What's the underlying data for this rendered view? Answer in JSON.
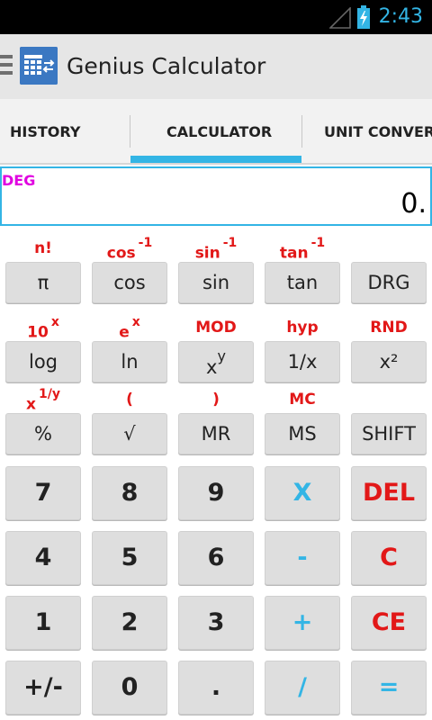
{
  "status": {
    "time": "2:43"
  },
  "app": {
    "title": "Genius Calculator"
  },
  "tabs": [
    {
      "label": "HISTORY"
    },
    {
      "label": "CALCULATOR"
    },
    {
      "label": "UNIT CONVERT"
    }
  ],
  "display": {
    "mode": "DEG",
    "value": "0."
  },
  "shift_labels": {
    "row1": [
      {
        "base": "n!",
        "sup": ""
      },
      {
        "base": "cos",
        "sup": "-1"
      },
      {
        "base": "sin",
        "sup": "-1"
      },
      {
        "base": "tan",
        "sup": "-1"
      }
    ],
    "row2": [
      {
        "base": "10",
        "sup": "x"
      },
      {
        "base": "e",
        "sup": "x"
      },
      {
        "base": "MOD",
        "sup": ""
      },
      {
        "base": "hyp",
        "sup": ""
      },
      {
        "base": "RND",
        "sup": ""
      }
    ],
    "row3": [
      {
        "base": "x",
        "sup": "1/y"
      },
      {
        "base": "(",
        "sup": ""
      },
      {
        "base": ")",
        "sup": ""
      },
      {
        "base": "MC",
        "sup": ""
      }
    ]
  },
  "keys": {
    "row1": [
      "π",
      "cos",
      "sin",
      "tan",
      "DRG"
    ],
    "row2": [
      "log",
      "ln",
      "x",
      "1/x",
      "x²"
    ],
    "row2_sup": "y",
    "row3": [
      "%",
      "√",
      "MR",
      "MS",
      "SHIFT"
    ],
    "row4": [
      "7",
      "8",
      "9",
      "X",
      "DEL"
    ],
    "row5": [
      "4",
      "5",
      "6",
      "-",
      "C"
    ],
    "row6": [
      "1",
      "2",
      "3",
      "+",
      "CE"
    ],
    "row7": [
      "+/-",
      "0",
      ".",
      "/",
      "="
    ]
  },
  "colors": {
    "accent": "#33b5e5",
    "shift": "#e21818",
    "mode": "#e000e0",
    "key": "#dedede"
  }
}
